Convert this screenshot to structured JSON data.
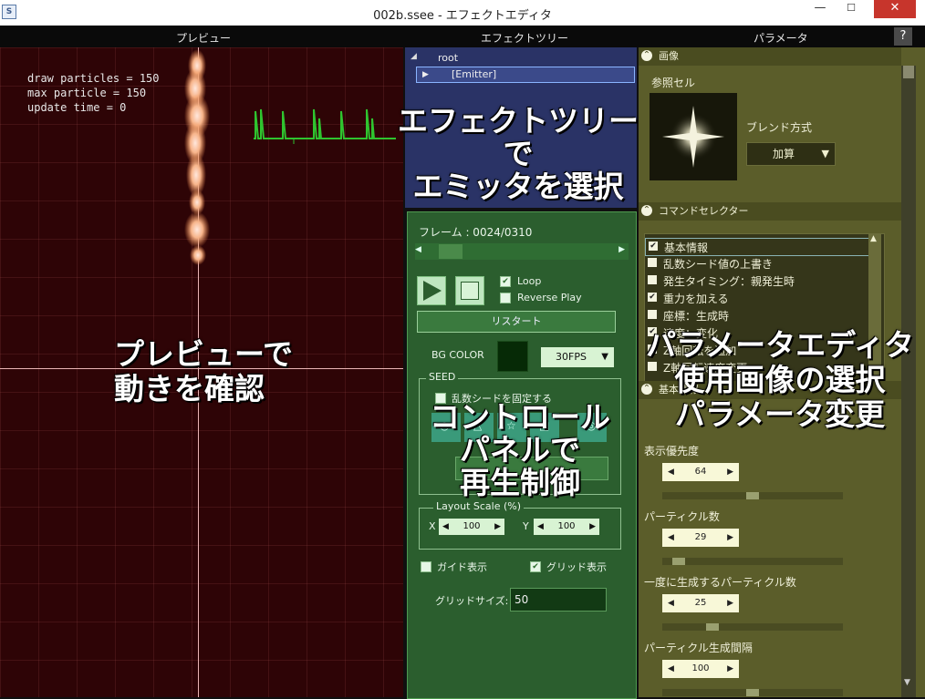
{
  "window": {
    "title": "002b.ssee - エフェクトエディタ",
    "app_icon": "S",
    "minimize": "—",
    "maximize": "☐",
    "close": "✕"
  },
  "header": {
    "preview": "プレビュー",
    "tree": "エフェクトツリー",
    "params": "パラメータ",
    "help": "?"
  },
  "preview": {
    "stats": [
      "draw particles = 150",
      "max particle = 150",
      "update time = 0"
    ],
    "caption": [
      "プレビューで",
      "動きを確認"
    ]
  },
  "tree": {
    "root_label": "root",
    "emitter_label": "[Emitter]",
    "caption": [
      "エフェクトツリーで",
      "エミッタを選択"
    ]
  },
  "control": {
    "frame_label": "フレーム : 0024/0310",
    "loop_label": "Loop",
    "reverse_label": "Reverse Play",
    "restart_label": "リスタート",
    "bgcolor_label": "BG COLOR",
    "fps_value": "30FPS",
    "seed_group": "SEED",
    "seed_fix_label": "乱数シードを固定する",
    "layout_group": "Layout Scale (%)",
    "scale_x_label": "X",
    "scale_x_value": "100",
    "scale_y_label": "Y",
    "scale_y_value": "100",
    "guide_label": "ガイド表示",
    "grid_label": "グリッド表示",
    "grid_size_label": "グリッドサイズ:",
    "grid_size_value": "50",
    "caption": [
      "コントロール",
      "パネルで",
      "再生制御"
    ]
  },
  "params": {
    "image_section": "画像",
    "ref_cell_label": "参照セル",
    "blend_label": "ブレンド方式",
    "blend_value": "加算",
    "cmd_section": "コマンドセレクター",
    "commands": [
      {
        "label": "基本情報",
        "checked": "✔"
      },
      {
        "label": "乱数シード値の上書き",
        "checked": ""
      },
      {
        "label": "発生タイミング：親発生時",
        "checked": ""
      },
      {
        "label": "重力を加える",
        "checked": "✔"
      },
      {
        "label": "座標：生成時",
        "checked": ""
      },
      {
        "label": "速度：変化",
        "checked": "✔"
      },
      {
        "label": "Z軸回転を追加",
        "checked": "✔"
      },
      {
        "label": "Z軸回転速度変更",
        "checked": ""
      }
    ],
    "basic_section": "基本情報",
    "fields": [
      {
        "label": "表示優先度",
        "value": "64",
        "fill": 0.5
      },
      {
        "label": "パーティクル数",
        "value": "29",
        "fill": 0.06
      },
      {
        "label": "一度に生成するパーティクル数",
        "value": "25",
        "fill": 0.26
      },
      {
        "label": "パーティクル生成間隔",
        "value": "100",
        "fill": 0.5
      }
    ],
    "caption": [
      "パラメータエディタ",
      "使用画像の選択",
      "パラメータ変更"
    ]
  }
}
